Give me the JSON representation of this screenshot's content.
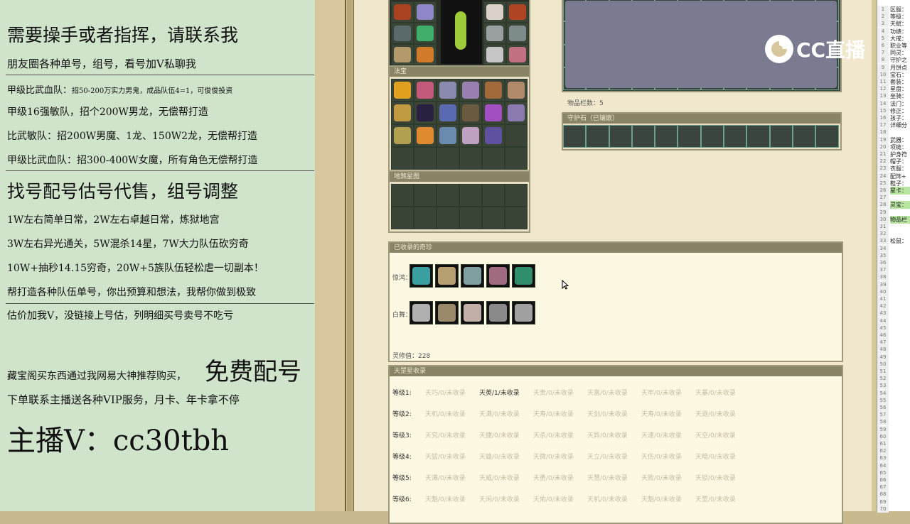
{
  "left_panel": {
    "lines": [
      {
        "text": "需要操手或者指挥，请联系我"
      },
      {
        "text": "朋友圈各种单号，组号，看号加V私聊我"
      },
      {
        "text": "甲级比武血队："
      },
      {
        "text": "招50-200万实力男鬼，成品队伍4=1，可俊俊投资"
      },
      {
        "text": "甲级16强敏队，招个200W男龙，无偿帮打造"
      },
      {
        "text": "比武敏队：招200W男魔、1龙、150W2龙，无偿帮打造"
      },
      {
        "text": "甲级比武血队：招300-400W女魔，所有角色无偿帮打造"
      },
      {
        "text": "找号配号估号代售，组号调整"
      },
      {
        "text": "1W左右简单日常，2W左右卓越日常，炼狱地宫"
      },
      {
        "text": "3W左右异光通关，5W混杀14星，7W大力队伍砍穷奇"
      },
      {
        "text": "10W+抽秒14.15穷奇，20W+5族队伍轻松虐一切副本！"
      },
      {
        "text": "帮打造各种队伍单号，你出预算和想法，我帮你做到极致"
      },
      {
        "text": "估价加我V，没链接上号估，列明细买号卖号不吃亏"
      },
      {
        "text": "藏宝阁买东西通过我网易大神推荐购买，"
      },
      {
        "text": "免费配号"
      },
      {
        "text": "下单联系主播送各种VIP服务，月卡、年卡拿不停"
      },
      {
        "text": "主播V：cc30tbh"
      }
    ]
  },
  "logo": {
    "text": "CC直播"
  },
  "game": {
    "fabao_title": "法宝",
    "dijie_title": "地煞星图",
    "item_count_label": "物品栏数：5",
    "guard_title": "守护石（已镶嵌）",
    "collected_title": "已收录的奇珍",
    "jinghong_label": "惊鸿：",
    "baiwu_label": "白舞：",
    "lingxiu_label": "灵修值：228",
    "tianzhu_title": "天罡星收录",
    "tiers": [
      {
        "label": "等级1:",
        "items": [
          "天巧/0/未收录",
          "天英/1/未收录",
          "天贵/0/未收录",
          "天富/0/未收录",
          "天牢/0/未收录",
          "天暴/0/未收录"
        ]
      },
      {
        "label": "等级2:",
        "items": [
          "天机/0/未收录",
          "天满/0/未收录",
          "天寿/0/未收录",
          "天剑/0/未收录",
          "天寿/0/未收录",
          "天退/0/未收录"
        ]
      },
      {
        "label": "等级3:",
        "items": [
          "天究/0/未收录",
          "天捷/0/未收录",
          "天杀/0/未收录",
          "天异/0/未收录",
          "天速/0/未收录",
          "天空/0/未收录"
        ]
      },
      {
        "label": "等级4:",
        "items": [
          "天猛/0/未收录",
          "天雄/0/未收录",
          "天微/0/未收录",
          "天立/0/未收录",
          "天伤/0/未收录",
          "天暗/0/未收录"
        ]
      },
      {
        "label": "等级5:",
        "items": [
          "天满/0/未收录",
          "天威/0/未收录",
          "天勇/0/未收录",
          "天慧/0/未收录",
          "天败/0/未收录",
          "天损/0/未收录"
        ]
      },
      {
        "label": "等级6:",
        "items": [
          "天魁/0/未收录",
          "天闲/0/未收录",
          "天佑/0/未收录",
          "天机/0/未收录",
          "天魁/0/未收录",
          "天罡/0/未收录"
        ]
      }
    ]
  },
  "sheet": {
    "rows": [
      {
        "n": "1",
        "label": "区服："
      },
      {
        "n": "2",
        "label": "等级："
      },
      {
        "n": "3",
        "label": "天赋："
      },
      {
        "n": "4",
        "label": "功绩："
      },
      {
        "n": "5",
        "label": "大戒："
      },
      {
        "n": "6",
        "label": "职业等"
      },
      {
        "n": "7",
        "label": "同灵："
      },
      {
        "n": "8",
        "label": "守护之"
      },
      {
        "n": "9",
        "label": "月饼点"
      },
      {
        "n": "10",
        "label": "宝石："
      },
      {
        "n": "11",
        "label": "套装："
      },
      {
        "n": "12",
        "label": "星盘："
      },
      {
        "n": "13",
        "label": "坐骑："
      },
      {
        "n": "14",
        "label": "法门："
      },
      {
        "n": "15",
        "label": "修正："
      },
      {
        "n": "16",
        "label": "孩子："
      },
      {
        "n": "17",
        "label": "详细分"
      },
      {
        "n": "18",
        "label": ""
      },
      {
        "n": "19",
        "label": "武器："
      },
      {
        "n": "20",
        "label": "项链："
      },
      {
        "n": "21",
        "label": "护身符"
      },
      {
        "n": "22",
        "label": "帽子："
      },
      {
        "n": "23",
        "label": "衣服："
      },
      {
        "n": "24",
        "label": "配饰+"
      },
      {
        "n": "25",
        "label": "鞋子："
      },
      {
        "n": "26",
        "label": "星卡："
      },
      {
        "n": "27",
        "label": ""
      },
      {
        "n": "28",
        "label": "灵宝："
      },
      {
        "n": "29",
        "label": ""
      },
      {
        "n": "30",
        "label": "物品栏"
      },
      {
        "n": "31",
        "label": ""
      },
      {
        "n": "32",
        "label": ""
      },
      {
        "n": "33",
        "label": "松鼠："
      }
    ]
  }
}
